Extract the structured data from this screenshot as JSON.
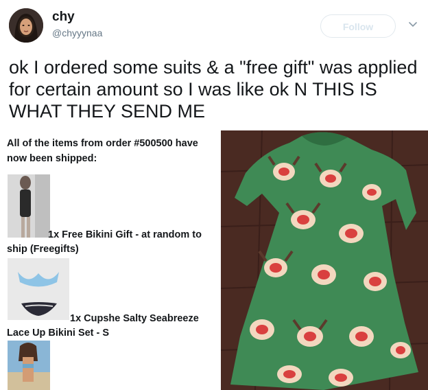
{
  "author": {
    "display_name": "chy",
    "handle": "@chyyynaa"
  },
  "follow_label": "Follow",
  "tweet_text": "ok I ordered some suits & a \"free gift\" was applied for certain amount so I was like ok N THIS IS WHAT THEY SEND ME",
  "email": {
    "intro": "All of the items from order #500500 have now been shipped:",
    "items": [
      {
        "label": "1x Free Bikini Gift - at random to ship (Freegifts)"
      },
      {
        "label": "1x Cupshe Salty Seabreeze Lace Up Bikini Set - S"
      }
    ]
  },
  "colors": {
    "dress_green": "#3f8a55",
    "floor_wood": "#4a2a22",
    "handle_gray": "#657786",
    "follow_border": "#e1e8ed"
  }
}
